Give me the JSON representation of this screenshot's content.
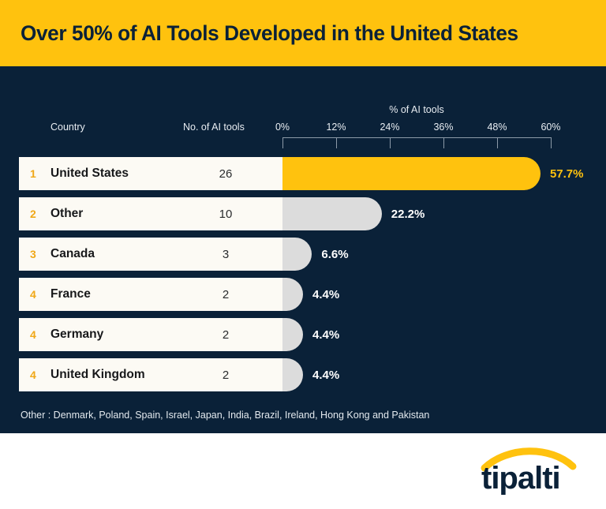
{
  "header": {
    "title": "Over 50% of AI Tools Developed in the United States",
    "background": "#FFC20E",
    "text_color": "#0A2138"
  },
  "theme": {
    "navy": "#0A2138",
    "yellow": "#FFC20E",
    "panel": "#FCFAF4",
    "gray_bar": "#DCDCDC",
    "rank_color": "#F0A818"
  },
  "table": {
    "col_country": "Country",
    "col_count": "No. of AI tools"
  },
  "footnote": "Other : Denmark, Poland, Spain, Israel, Japan, India, Brazil, Ireland, Hong Kong and Pakistan",
  "logo": {
    "wordmark": "tipalti"
  },
  "chart_data": {
    "type": "bar",
    "title": "Over 50% of AI Tools Developed in the United States",
    "xlabel": "% of AI tools",
    "ylabel": "",
    "orientation": "horizontal",
    "xlim": [
      0,
      60
    ],
    "xticks": [
      0,
      12,
      24,
      36,
      48,
      60
    ],
    "xticklabels": [
      "0%",
      "12%",
      "24%",
      "36%",
      "48%",
      "60%"
    ],
    "grid": false,
    "legend": null,
    "categories": [
      "United States",
      "Other",
      "Canada",
      "France",
      "Germany",
      "United Kingdom"
    ],
    "values": [
      57.7,
      22.2,
      6.6,
      4.4,
      4.4,
      4.4
    ],
    "value_labels": [
      "57.7%",
      "22.2%",
      "6.6%",
      "4.4%",
      "4.4%",
      "4.4%"
    ],
    "counts": [
      26,
      10,
      3,
      2,
      2,
      2
    ],
    "ranks": [
      "1",
      "2",
      "3",
      "4",
      "4",
      "4"
    ],
    "series": [
      {
        "name": "% of AI tools",
        "values": [
          57.7,
          22.2,
          6.6,
          4.4,
          4.4,
          4.4
        ]
      }
    ],
    "rows": [
      {
        "rank": "1",
        "country": "United States",
        "count": "26",
        "pct": 57.7,
        "pct_label": "57.7%",
        "highlight": true
      },
      {
        "rank": "2",
        "country": "Other",
        "count": "10",
        "pct": 22.2,
        "pct_label": "22.2%",
        "highlight": false
      },
      {
        "rank": "3",
        "country": "Canada",
        "count": "3",
        "pct": 6.6,
        "pct_label": "6.6%",
        "highlight": false
      },
      {
        "rank": "4",
        "country": "France",
        "count": "2",
        "pct": 4.4,
        "pct_label": "4.4%",
        "highlight": false
      },
      {
        "rank": "4",
        "country": "Germany",
        "count": "2",
        "pct": 4.4,
        "pct_label": "4.4%",
        "highlight": false
      },
      {
        "rank": "4",
        "country": "United Kingdom",
        "count": "2",
        "pct": 4.4,
        "pct_label": "4.4%",
        "highlight": false
      }
    ]
  }
}
